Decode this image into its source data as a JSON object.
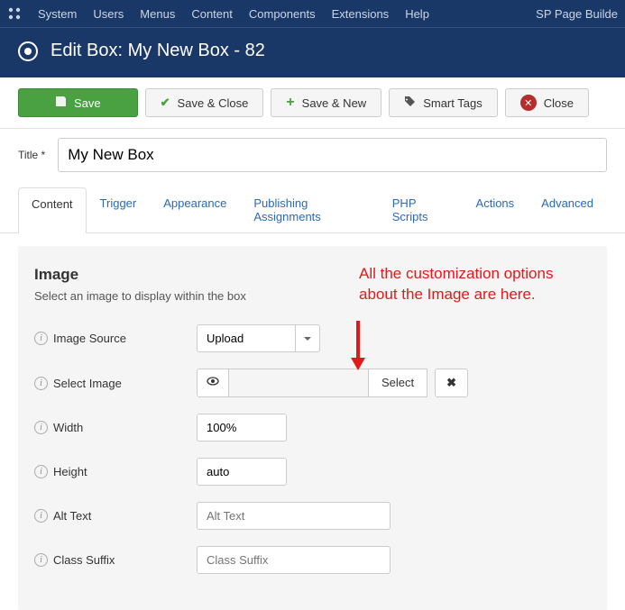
{
  "topbar": {
    "items": [
      "System",
      "Users",
      "Menus",
      "Content",
      "Components",
      "Extensions",
      "Help"
    ],
    "right": "SP Page Builde"
  },
  "header": {
    "title": "Edit Box: My New Box - 82"
  },
  "toolbar": {
    "save": "Save",
    "saveClose": "Save & Close",
    "saveNew": "Save & New",
    "smartTags": "Smart Tags",
    "close": "Close"
  },
  "titleField": {
    "label": "Title *",
    "value": "My New Box"
  },
  "tabs": [
    "Content",
    "Trigger",
    "Appearance",
    "Publishing Assignments",
    "PHP Scripts",
    "Actions",
    "Advanced"
  ],
  "activeTab": 0,
  "panel": {
    "heading": "Image",
    "desc": "Select an image to display within the box",
    "fields": {
      "imageSource": {
        "label": "Image Source",
        "value": "Upload"
      },
      "selectImage": {
        "label": "Select Image",
        "button": "Select"
      },
      "width": {
        "label": "Width",
        "value": "100%"
      },
      "height": {
        "label": "Height",
        "value": "auto"
      },
      "altText": {
        "label": "Alt Text",
        "placeholder": "Alt Text"
      },
      "classSuffix": {
        "label": "Class Suffix",
        "placeholder": "Class Suffix"
      }
    }
  },
  "annotation": {
    "line1": "All the customization options",
    "line2": "about the Image are here."
  }
}
